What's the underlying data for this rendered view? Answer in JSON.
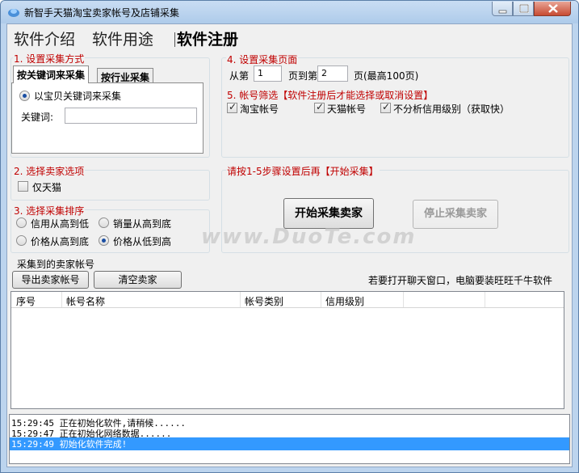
{
  "window": {
    "title": "新智手天猫淘宝卖家帐号及店铺采集"
  },
  "menu": {
    "intro": "软件介绍",
    "usage": "软件用途",
    "register": "软件注册"
  },
  "section1": {
    "title": "1. 设置采集方式",
    "tab_keyword": "按关键词来采集",
    "tab_industry": "按行业采集",
    "radio_keyword": "以宝贝关键词来采集",
    "keyword_label": "关键词:",
    "keyword_value": ""
  },
  "section2": {
    "title": "2. 选择卖家选项",
    "tmall_only": "仅天猫"
  },
  "section3": {
    "title": "3. 选择采集排序",
    "credit_desc": "信用从高到低",
    "sales_desc": "销量从高到底",
    "price_desc": "价格从高到底",
    "price_asc": "价格从低到高"
  },
  "section4": {
    "title": "4. 设置采集页面",
    "from_label": "从第",
    "from_value": "1",
    "to_label": "页到第",
    "to_value": "2",
    "max_label": "页(最高100页)"
  },
  "section5": {
    "title": "5. 帐号筛选【软件注册后才能选择或取消设置】",
    "taobao": "淘宝帐号",
    "tmall": "天猫帐号",
    "no_credit": "不分析信用级别（获取快）"
  },
  "actions": {
    "hint": "请按1-5步骤设置后再【开始采集】",
    "start": "开始采集卖家",
    "stop": "停止采集卖家"
  },
  "results": {
    "title": "采集到的卖家帐号",
    "export": "导出卖家帐号",
    "clear": "清空卖家",
    "notice": "若要打开聊天窗口，电脑要装旺旺千牛软件",
    "columns": [
      "序号",
      "帐号名称",
      "帐号类别",
      "信用级别",
      "",
      ""
    ]
  },
  "log": [
    {
      "time": "15:29:45",
      "text": "正在初始化软件,请稍候......"
    },
    {
      "time": "15:29:47",
      "text": "正在初始化网络数据......"
    },
    {
      "time": "15:29:49",
      "text": "初始化软件完成!"
    }
  ],
  "watermark": "www.DuoTe.com",
  "colors": {
    "section_title": "#c00000",
    "selection": "#3399ff",
    "frame": "#bcd4ee"
  }
}
